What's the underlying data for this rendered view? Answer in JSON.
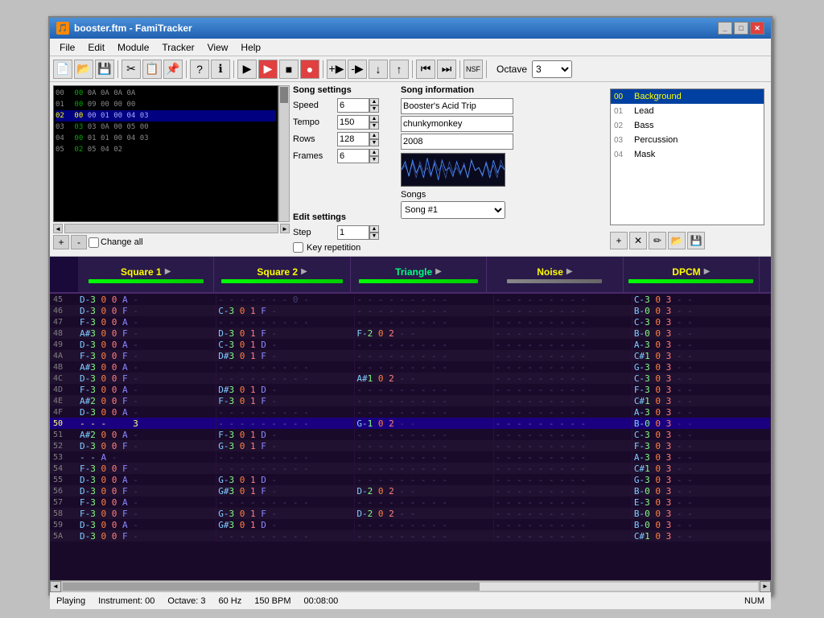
{
  "window": {
    "title": "booster.ftm - FamiTracker",
    "icon": "🎵"
  },
  "menu": {
    "items": [
      "File",
      "Edit",
      "Module",
      "Tracker",
      "View",
      "Help"
    ]
  },
  "toolbar": {
    "octave_label": "Octave",
    "octave_value": "3"
  },
  "song_settings": {
    "title": "Song settings",
    "speed_label": "Speed",
    "speed_value": "6",
    "tempo_label": "Tempo",
    "tempo_value": "150",
    "rows_label": "Rows",
    "rows_value": "128",
    "frames_label": "Frames",
    "frames_value": "6"
  },
  "edit_settings": {
    "title": "Edit settings",
    "step_label": "Step",
    "step_value": "1",
    "key_repetition_label": "Key repetition"
  },
  "song_info": {
    "title": "Song information",
    "title_value": "Booster's Acid Trip",
    "author_value": "chunkymonkey",
    "year_value": "2008",
    "songs_label": "Songs",
    "song_select": "Song #1"
  },
  "instruments": {
    "list": [
      {
        "num": "00",
        "name": "Background",
        "selected": true
      },
      {
        "num": "01",
        "name": "Lead",
        "selected": false
      },
      {
        "num": "02",
        "name": "Bass",
        "selected": false
      },
      {
        "num": "03",
        "name": "Percussion",
        "selected": false
      },
      {
        "num": "04",
        "name": "Mask",
        "selected": false
      }
    ]
  },
  "channels": [
    {
      "name": "Square 1",
      "color": "yellow"
    },
    {
      "name": "Square 2",
      "color": "yellow"
    },
    {
      "name": "Triangle",
      "color": "green-ch"
    },
    {
      "name": "Noise",
      "color": "yellow"
    },
    {
      "name": "DPCM",
      "color": "yellow"
    }
  ],
  "pattern_rows": [
    {
      "num": "45",
      "s1": "D- 3 0 0 A -",
      "s2": "- - - - - - - 0 -",
      "tri": "- - - - - - - - -",
      "noise": "- - - - - - - - -",
      "dpcm": "C- 3 0 3 - -"
    },
    {
      "num": "46",
      "s1": "D- 3 0 0 F -",
      "s2": "C- 3 0 1 F -",
      "tri": "- - - - - - - - -",
      "noise": "- - - - - - - - -",
      "dpcm": "B- 0 0 3 - -"
    },
    {
      "num": "47",
      "s1": "F- 3 0 0 A -",
      "s2": "- - - - - - - - -",
      "tri": "- - - - - - - - -",
      "noise": "- - - - - - - - -",
      "dpcm": "C- 3 0 3 - -"
    },
    {
      "num": "48",
      "s1": "A#3 0 0 F -",
      "s2": "D- 3 0 1 F -",
      "tri": "F- 2 0 2 - -",
      "noise": "- - - - - - - - -",
      "dpcm": "B- 0 0 3 - -"
    },
    {
      "num": "49",
      "s1": "D- 3 0 0 A -",
      "s2": "C- 3 0 1 D -",
      "tri": "- - - - - - - - -",
      "noise": "- - - - - - - - -",
      "dpcm": "A- 3 0 3 - -"
    },
    {
      "num": "4A",
      "s1": "F- 3 0 0 F -",
      "s2": "D#3 0 1 F -",
      "tri": "- - - - - - - - -",
      "noise": "- - - - - - - - -",
      "dpcm": "C#1 0 3 - -"
    },
    {
      "num": "4B",
      "s1": "A#3 0 0 A -",
      "s2": "- - - - - - - - -",
      "tri": "- - - - - - - - -",
      "noise": "- - - - - - - - -",
      "dpcm": "G- 3 0 3 - -"
    },
    {
      "num": "4C",
      "s1": "D- 3 0 0 F -",
      "s2": "- - - - - - - - -",
      "tri": "A#1 0 2 - -",
      "noise": "- - - - - - - - -",
      "dpcm": "C- 3 0 3 - -"
    },
    {
      "num": "4D",
      "s1": "F- 3 0 0 A -",
      "s2": "D#3 0 1 D -",
      "tri": "- - - - - - - - -",
      "noise": "- - - - - - - - -",
      "dpcm": "F- 3 0 3 - -"
    },
    {
      "num": "4E",
      "s1": "A#2 0 0 F -",
      "s2": "F- 3 0 1 F -",
      "tri": "- - - - - - - - -",
      "noise": "- - - - - - - - -",
      "dpcm": "C#1 0 3 - -"
    },
    {
      "num": "4F",
      "s1": "D- 3 0 0 A -",
      "s2": "- - - - - - - - -",
      "tri": "- - - - - - - - -",
      "noise": "- - - - - - - - -",
      "dpcm": "A- 3 0 3 - -"
    },
    {
      "num": "50",
      "s1": "- - - - - 3 -",
      "s2": "- - - - - - - - -",
      "tri": "G- 1 0 2 - -",
      "noise": "- - - - - - - - -",
      "dpcm": "B- 0 0 3 - -",
      "selected": true
    },
    {
      "num": "51",
      "s1": "A#2 0 0 A -",
      "s2": "F- 3 0 1 D -",
      "tri": "- - - - - - - - -",
      "noise": "- - - - - - - - -",
      "dpcm": "C- 3 0 3 - -"
    },
    {
      "num": "52",
      "s1": "D- 3 0 0 F -",
      "s2": "G- 3 0 1 F -",
      "tri": "- - - - - - - - -",
      "noise": "- - - - - - - - -",
      "dpcm": "F- 3 0 3 - -"
    },
    {
      "num": "53",
      "s1": "- - - - A -",
      "s2": "- - - - - - - - -",
      "tri": "- - - - - - - - -",
      "noise": "- - - - - - - - -",
      "dpcm": "A- 3 0 3 - -"
    },
    {
      "num": "54",
      "s1": "F- 3 0 0 F -",
      "s2": "- - - - - - - - -",
      "tri": "- - - - - - - - -",
      "noise": "- - - - - - - - -",
      "dpcm": "C#1 0 3 - -"
    },
    {
      "num": "55",
      "s1": "D- 3 0 0 A -",
      "s2": "G- 3 0 1 D -",
      "tri": "- - - - - - - - -",
      "noise": "- - - - - - - - -",
      "dpcm": "G- 3 0 3 - -"
    },
    {
      "num": "56",
      "s1": "D- 3 0 0 F -",
      "s2": "G#3 0 1 F -",
      "tri": "D- 2 0 2 - -",
      "noise": "- - - - - - - - -",
      "dpcm": "B- 0 0 3 - -"
    },
    {
      "num": "57",
      "s1": "F- 3 0 0 A -",
      "s2": "- - - - - - - - -",
      "tri": "- - - - - - - - -",
      "noise": "- - - - - - - - -",
      "dpcm": "E- 3 0 3 - -"
    },
    {
      "num": "58",
      "s1": "F- 3 0 0 F -",
      "s2": "G- 3 0 1 F -",
      "tri": "D- 2 0 2 - -",
      "noise": "- - - - - - - - -",
      "dpcm": "B- 0 0 3 - -"
    },
    {
      "num": "59",
      "s1": "D- 3 0 0 A -",
      "s2": "G#3 0 1 D -",
      "tri": "- - - - - - - - -",
      "noise": "- - - - - - - - -",
      "dpcm": "B- 0 0 3 - -"
    },
    {
      "num": "5A",
      "s1": "D- 3 0 0 F -",
      "s2": "- - - - - - - - -",
      "tri": "- - - - - - - - -",
      "noise": "- - - - - - - - -",
      "dpcm": "C#1 0 3 - -"
    }
  ],
  "pattern_mini": {
    "rows": [
      {
        "num": "00",
        "data": "00  0A 0A 0A 0A"
      },
      {
        "num": "01",
        "data": "00  09 00 00 00"
      },
      {
        "num": "02",
        "data": "00  00 01 00 04 03",
        "selected": true
      },
      {
        "num": "03",
        "data": "03  03 0A 00 05 00"
      },
      {
        "num": "04",
        "data": "00  01 01 00 04 03"
      },
      {
        "num": "05",
        "data": "02  05 04 02"
      }
    ]
  },
  "statusbar": {
    "playing": "Playing",
    "instrument": "Instrument: 00",
    "octave": "Octave: 3",
    "hz": "60 Hz",
    "bpm": "150 BPM",
    "time": "00:08:00",
    "num": "NUM"
  }
}
